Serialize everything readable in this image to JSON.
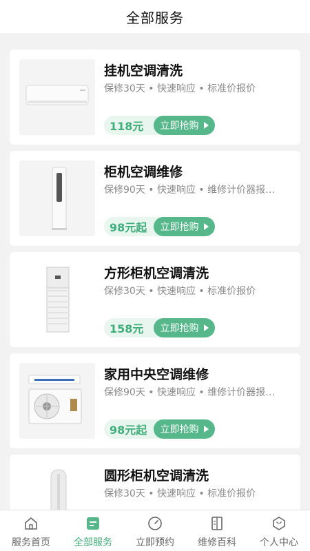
{
  "header": {
    "title": "全部服务"
  },
  "services": [
    {
      "title": "挂机空调清洗",
      "desc": "保修30天 • 快速响应 • 标准价报价",
      "price": "118元",
      "button": "立即抢购",
      "image": "wall-ac"
    },
    {
      "title": "柜机空调维修",
      "desc": "保修90天 • 快速响应 • 维修计价器报价…",
      "price": "98元起",
      "button": "立即抢购",
      "image": "tower-ac"
    },
    {
      "title": "方形柜机空调清洗",
      "desc": "保修30天 • 快速响应 • 标准价报价",
      "price": "158元",
      "button": "立即抢购",
      "image": "square-cabinet-ac"
    },
    {
      "title": "家用中央空调维修",
      "desc": "保修90天 • 快速响应 • 维修计价器报价…",
      "price": "98元起",
      "button": "立即抢购",
      "image": "central-ac"
    },
    {
      "title": "圆形柜机空调清洗",
      "desc": "保修30天 • 快速响应 • 标准价报价",
      "price": "",
      "button": "",
      "image": "round-cabinet-ac"
    }
  ],
  "tabbar": {
    "items": [
      {
        "label": "服务首页",
        "icon": "home-icon"
      },
      {
        "label": "全部服务",
        "icon": "services-icon",
        "active": true
      },
      {
        "label": "立即预约",
        "icon": "clock-icon"
      },
      {
        "label": "维修百科",
        "icon": "book-icon"
      },
      {
        "label": "个人中心",
        "icon": "profile-icon"
      }
    ]
  },
  "colors": {
    "accent": "#56b88a",
    "accent_text": "#3fae7a",
    "price_bg": "#e9f6ef"
  }
}
